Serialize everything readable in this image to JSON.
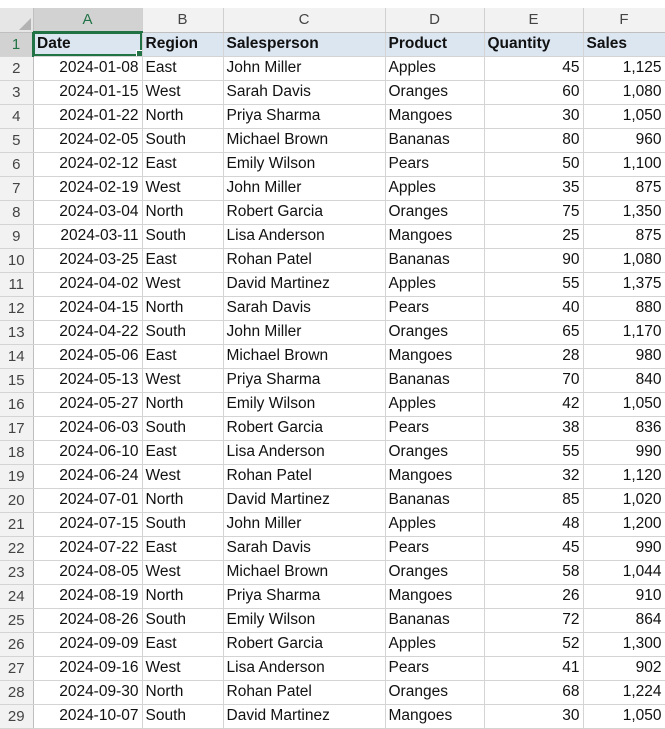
{
  "sheet": {
    "columns": [
      "A",
      "B",
      "C",
      "D",
      "E",
      "F"
    ],
    "header_row": {
      "row_number": "1",
      "cells": [
        "Date",
        "Region",
        "Salesperson",
        "Product",
        "Quantity",
        "Sales"
      ]
    },
    "rows": [
      {
        "row_number": "2",
        "date": "2024-01-08",
        "region": "East",
        "salesperson": "John Miller",
        "product": "Apples",
        "quantity": "45",
        "sales": "1,125"
      },
      {
        "row_number": "3",
        "date": "2024-01-15",
        "region": "West",
        "salesperson": "Sarah Davis",
        "product": "Oranges",
        "quantity": "60",
        "sales": "1,080"
      },
      {
        "row_number": "4",
        "date": "2024-01-22",
        "region": "North",
        "salesperson": "Priya Sharma",
        "product": "Mangoes",
        "quantity": "30",
        "sales": "1,050"
      },
      {
        "row_number": "5",
        "date": "2024-02-05",
        "region": "South",
        "salesperson": "Michael Brown",
        "product": "Bananas",
        "quantity": "80",
        "sales": "960"
      },
      {
        "row_number": "6",
        "date": "2024-02-12",
        "region": "East",
        "salesperson": "Emily Wilson",
        "product": "Pears",
        "quantity": "50",
        "sales": "1,100"
      },
      {
        "row_number": "7",
        "date": "2024-02-19",
        "region": "West",
        "salesperson": "John Miller",
        "product": "Apples",
        "quantity": "35",
        "sales": "875"
      },
      {
        "row_number": "8",
        "date": "2024-03-04",
        "region": "North",
        "salesperson": "Robert Garcia",
        "product": "Oranges",
        "quantity": "75",
        "sales": "1,350"
      },
      {
        "row_number": "9",
        "date": "2024-03-11",
        "region": "South",
        "salesperson": "Lisa Anderson",
        "product": "Mangoes",
        "quantity": "25",
        "sales": "875"
      },
      {
        "row_number": "10",
        "date": "2024-03-25",
        "region": "East",
        "salesperson": "Rohan Patel",
        "product": "Bananas",
        "quantity": "90",
        "sales": "1,080"
      },
      {
        "row_number": "11",
        "date": "2024-04-02",
        "region": "West",
        "salesperson": "David Martinez",
        "product": "Apples",
        "quantity": "55",
        "sales": "1,375"
      },
      {
        "row_number": "12",
        "date": "2024-04-15",
        "region": "North",
        "salesperson": "Sarah Davis",
        "product": "Pears",
        "quantity": "40",
        "sales": "880"
      },
      {
        "row_number": "13",
        "date": "2024-04-22",
        "region": "South",
        "salesperson": "John Miller",
        "product": "Oranges",
        "quantity": "65",
        "sales": "1,170"
      },
      {
        "row_number": "14",
        "date": "2024-05-06",
        "region": "East",
        "salesperson": "Michael Brown",
        "product": "Mangoes",
        "quantity": "28",
        "sales": "980"
      },
      {
        "row_number": "15",
        "date": "2024-05-13",
        "region": "West",
        "salesperson": "Priya Sharma",
        "product": "Bananas",
        "quantity": "70",
        "sales": "840"
      },
      {
        "row_number": "16",
        "date": "2024-05-27",
        "region": "North",
        "salesperson": "Emily Wilson",
        "product": "Apples",
        "quantity": "42",
        "sales": "1,050"
      },
      {
        "row_number": "17",
        "date": "2024-06-03",
        "region": "South",
        "salesperson": "Robert Garcia",
        "product": "Pears",
        "quantity": "38",
        "sales": "836"
      },
      {
        "row_number": "18",
        "date": "2024-06-10",
        "region": "East",
        "salesperson": "Lisa Anderson",
        "product": "Oranges",
        "quantity": "55",
        "sales": "990"
      },
      {
        "row_number": "19",
        "date": "2024-06-24",
        "region": "West",
        "salesperson": "Rohan Patel",
        "product": "Mangoes",
        "quantity": "32",
        "sales": "1,120"
      },
      {
        "row_number": "20",
        "date": "2024-07-01",
        "region": "North",
        "salesperson": "David Martinez",
        "product": "Bananas",
        "quantity": "85",
        "sales": "1,020"
      },
      {
        "row_number": "21",
        "date": "2024-07-15",
        "region": "South",
        "salesperson": "John Miller",
        "product": "Apples",
        "quantity": "48",
        "sales": "1,200"
      },
      {
        "row_number": "22",
        "date": "2024-07-22",
        "region": "East",
        "salesperson": "Sarah Davis",
        "product": "Pears",
        "quantity": "45",
        "sales": "990"
      },
      {
        "row_number": "23",
        "date": "2024-08-05",
        "region": "West",
        "salesperson": "Michael Brown",
        "product": "Oranges",
        "quantity": "58",
        "sales": "1,044"
      },
      {
        "row_number": "24",
        "date": "2024-08-19",
        "region": "North",
        "salesperson": "Priya Sharma",
        "product": "Mangoes",
        "quantity": "26",
        "sales": "910"
      },
      {
        "row_number": "25",
        "date": "2024-08-26",
        "region": "South",
        "salesperson": "Emily Wilson",
        "product": "Bananas",
        "quantity": "72",
        "sales": "864"
      },
      {
        "row_number": "26",
        "date": "2024-09-09",
        "region": "East",
        "salesperson": "Robert Garcia",
        "product": "Apples",
        "quantity": "52",
        "sales": "1,300"
      },
      {
        "row_number": "27",
        "date": "2024-09-16",
        "region": "West",
        "salesperson": "Lisa Anderson",
        "product": "Pears",
        "quantity": "41",
        "sales": "902"
      },
      {
        "row_number": "28",
        "date": "2024-09-30",
        "region": "North",
        "salesperson": "Rohan Patel",
        "product": "Oranges",
        "quantity": "68",
        "sales": "1,224"
      },
      {
        "row_number": "29",
        "date": "2024-10-07",
        "region": "South",
        "salesperson": "David Martinez",
        "product": "Mangoes",
        "quantity": "30",
        "sales": "1,050"
      }
    ]
  },
  "selection": {
    "active_cell": "A1",
    "accent_color": "#217346"
  },
  "colors": {
    "header_fill": "#dce6f1",
    "gridline": "#d4d4d4",
    "heading_bg": "#f2f2f2"
  },
  "icons": {
    "select_all": "select-all-triangle-icon"
  }
}
